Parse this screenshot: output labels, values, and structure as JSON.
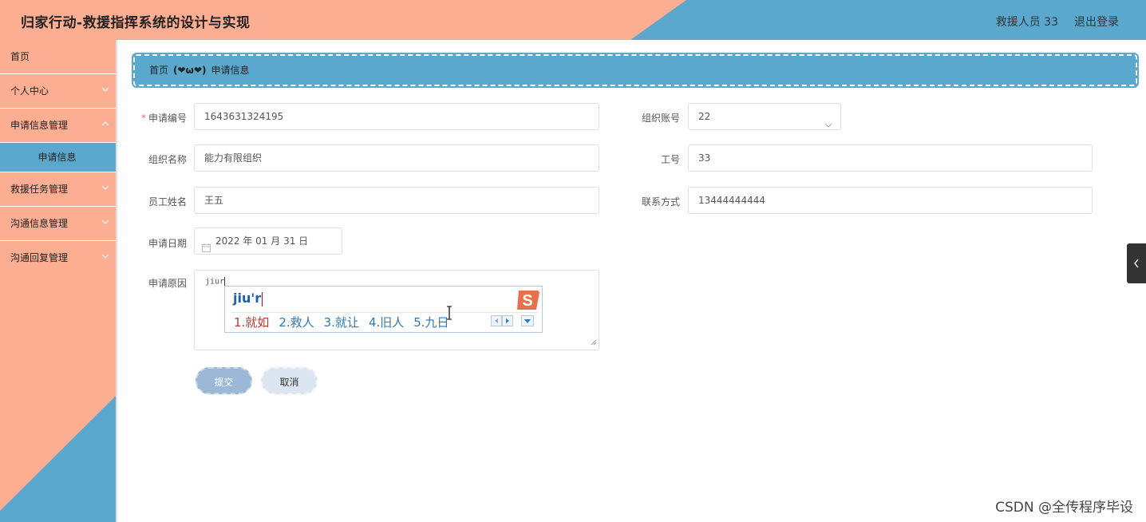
{
  "header": {
    "title": "归家行动-救援指挥系统的设计与实现",
    "user": "救援人员 33",
    "logout": "退出登录"
  },
  "sidebar": {
    "items": [
      {
        "label": "首页"
      },
      {
        "label": "个人中心"
      },
      {
        "label": "申请信息管理"
      },
      {
        "label": "申请信息"
      },
      {
        "label": "救援任务管理"
      },
      {
        "label": "沟通信息管理"
      },
      {
        "label": "沟通回复管理"
      }
    ]
  },
  "breadcrumb": {
    "home": "首页",
    "separator": "(❤ω❤)",
    "current": "申请信息"
  },
  "form": {
    "required_mark": "*",
    "app_no_label": "申请编号",
    "app_no_value": "1643631324195",
    "org_account_label": "组织账号",
    "org_account_value": "22",
    "org_name_label": "组织名称",
    "org_name_value": "能力有限组织",
    "job_no_label": "工号",
    "job_no_value": "33",
    "emp_name_label": "员工姓名",
    "emp_name_value": "王五",
    "contact_label": "联系方式",
    "contact_value": "13444444444",
    "date_label": "申请日期",
    "date_value": "2022 年 01 月 31 日",
    "reason_label": "申请原因",
    "reason_value": "jiur",
    "submit": "提交",
    "cancel": "取消"
  },
  "ime": {
    "input": "jiu'r",
    "candidates": [
      "1.就如",
      "2.救人",
      "3.就让",
      "4.旧人",
      "5.九日"
    ]
  },
  "watermark": "CSDN @全传程序毕设",
  "colors": {
    "salmon": "#fcae92",
    "blue": "#5aa8cd"
  }
}
